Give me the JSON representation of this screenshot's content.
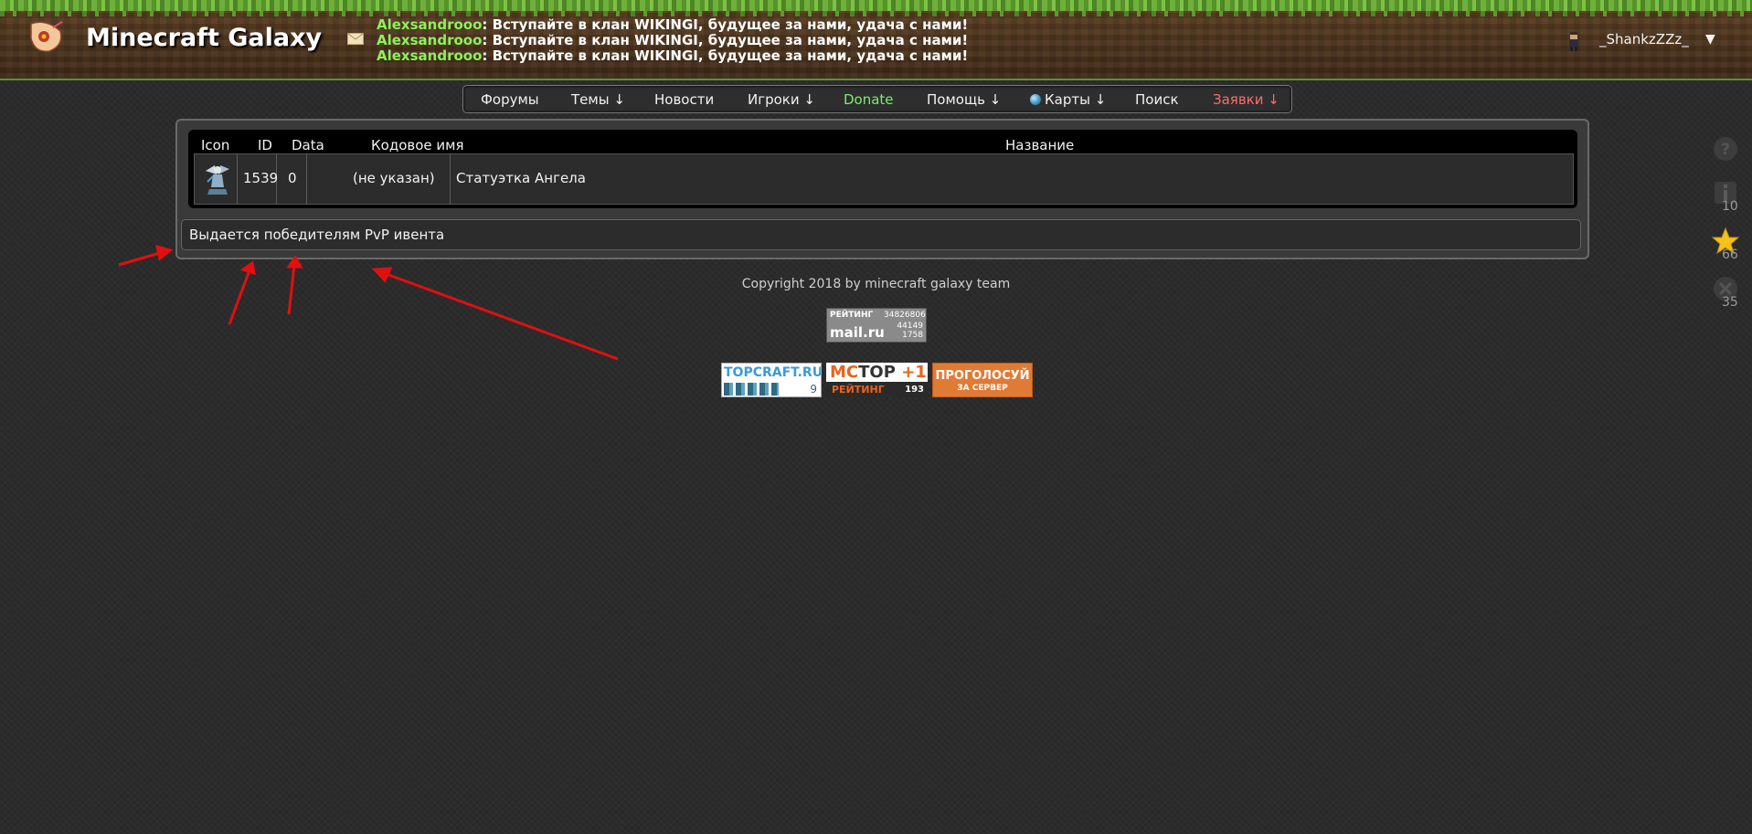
{
  "header": {
    "title": "Minecraft Galaxy",
    "shoutbox": [
      {
        "author": "Alexsandrooo",
        "message": ": Вступайте в клан WIKINGI, будущее за нами, удача с нами!"
      },
      {
        "author": "Alexsandrooo",
        "message": ": Вступайте в клан WIKINGI, будущее за нами, удача с нами!"
      },
      {
        "author": "Alexsandrooo",
        "message": ": Вступайте в клан WIKINGI, будущее за нами, удача с нами!"
      }
    ],
    "username": "_ShankzZZz_",
    "user_caret": "▼"
  },
  "nav": {
    "items": [
      {
        "label": "Форумы"
      },
      {
        "label": "Темы ↓"
      },
      {
        "label": "Новости"
      },
      {
        "label": "Игроки ↓"
      },
      {
        "label": "Donate"
      },
      {
        "label": "Помощь ↓"
      },
      {
        "label": "Карты ↓"
      },
      {
        "label": "Поиск"
      },
      {
        "label": "Заявки ↓"
      }
    ]
  },
  "table": {
    "headers": [
      "Icon",
      "ID",
      "Data",
      "Кодовое имя",
      "Название"
    ],
    "row": {
      "icon": "angel-statue-icon",
      "id": "1539",
      "data": "0",
      "code_name": "(не указан)",
      "name": "Статуэтка Ангела"
    }
  },
  "description": "Выдается победителям PvP ивента",
  "footer": {
    "copyright": "Copyright 2018 by minecraft galaxy team",
    "mailru": {
      "label": "РЕЙТИНГ",
      "num1": "34826806",
      "logo": "mail.ru",
      "num2": "44149",
      "num3": "1758"
    },
    "topcraft": {
      "label": "TOPCRAFT.RU",
      "count": "9"
    },
    "mctop": {
      "label_a": "MC",
      "label_b": "TOP",
      "plus": "+1",
      "rating": "РЕЙТИНГ",
      "count": "193"
    },
    "vote": {
      "line1": "ПРОГОЛОСУЙ",
      "line2": "ЗА СЕРВЕР"
    }
  },
  "side": {
    "info_count": "10",
    "star_count": "66",
    "close_count": "35"
  },
  "colors": {
    "accent_green": "#79f06b",
    "accent_red": "#ff6b6b",
    "arrow_red": "#e01010"
  }
}
